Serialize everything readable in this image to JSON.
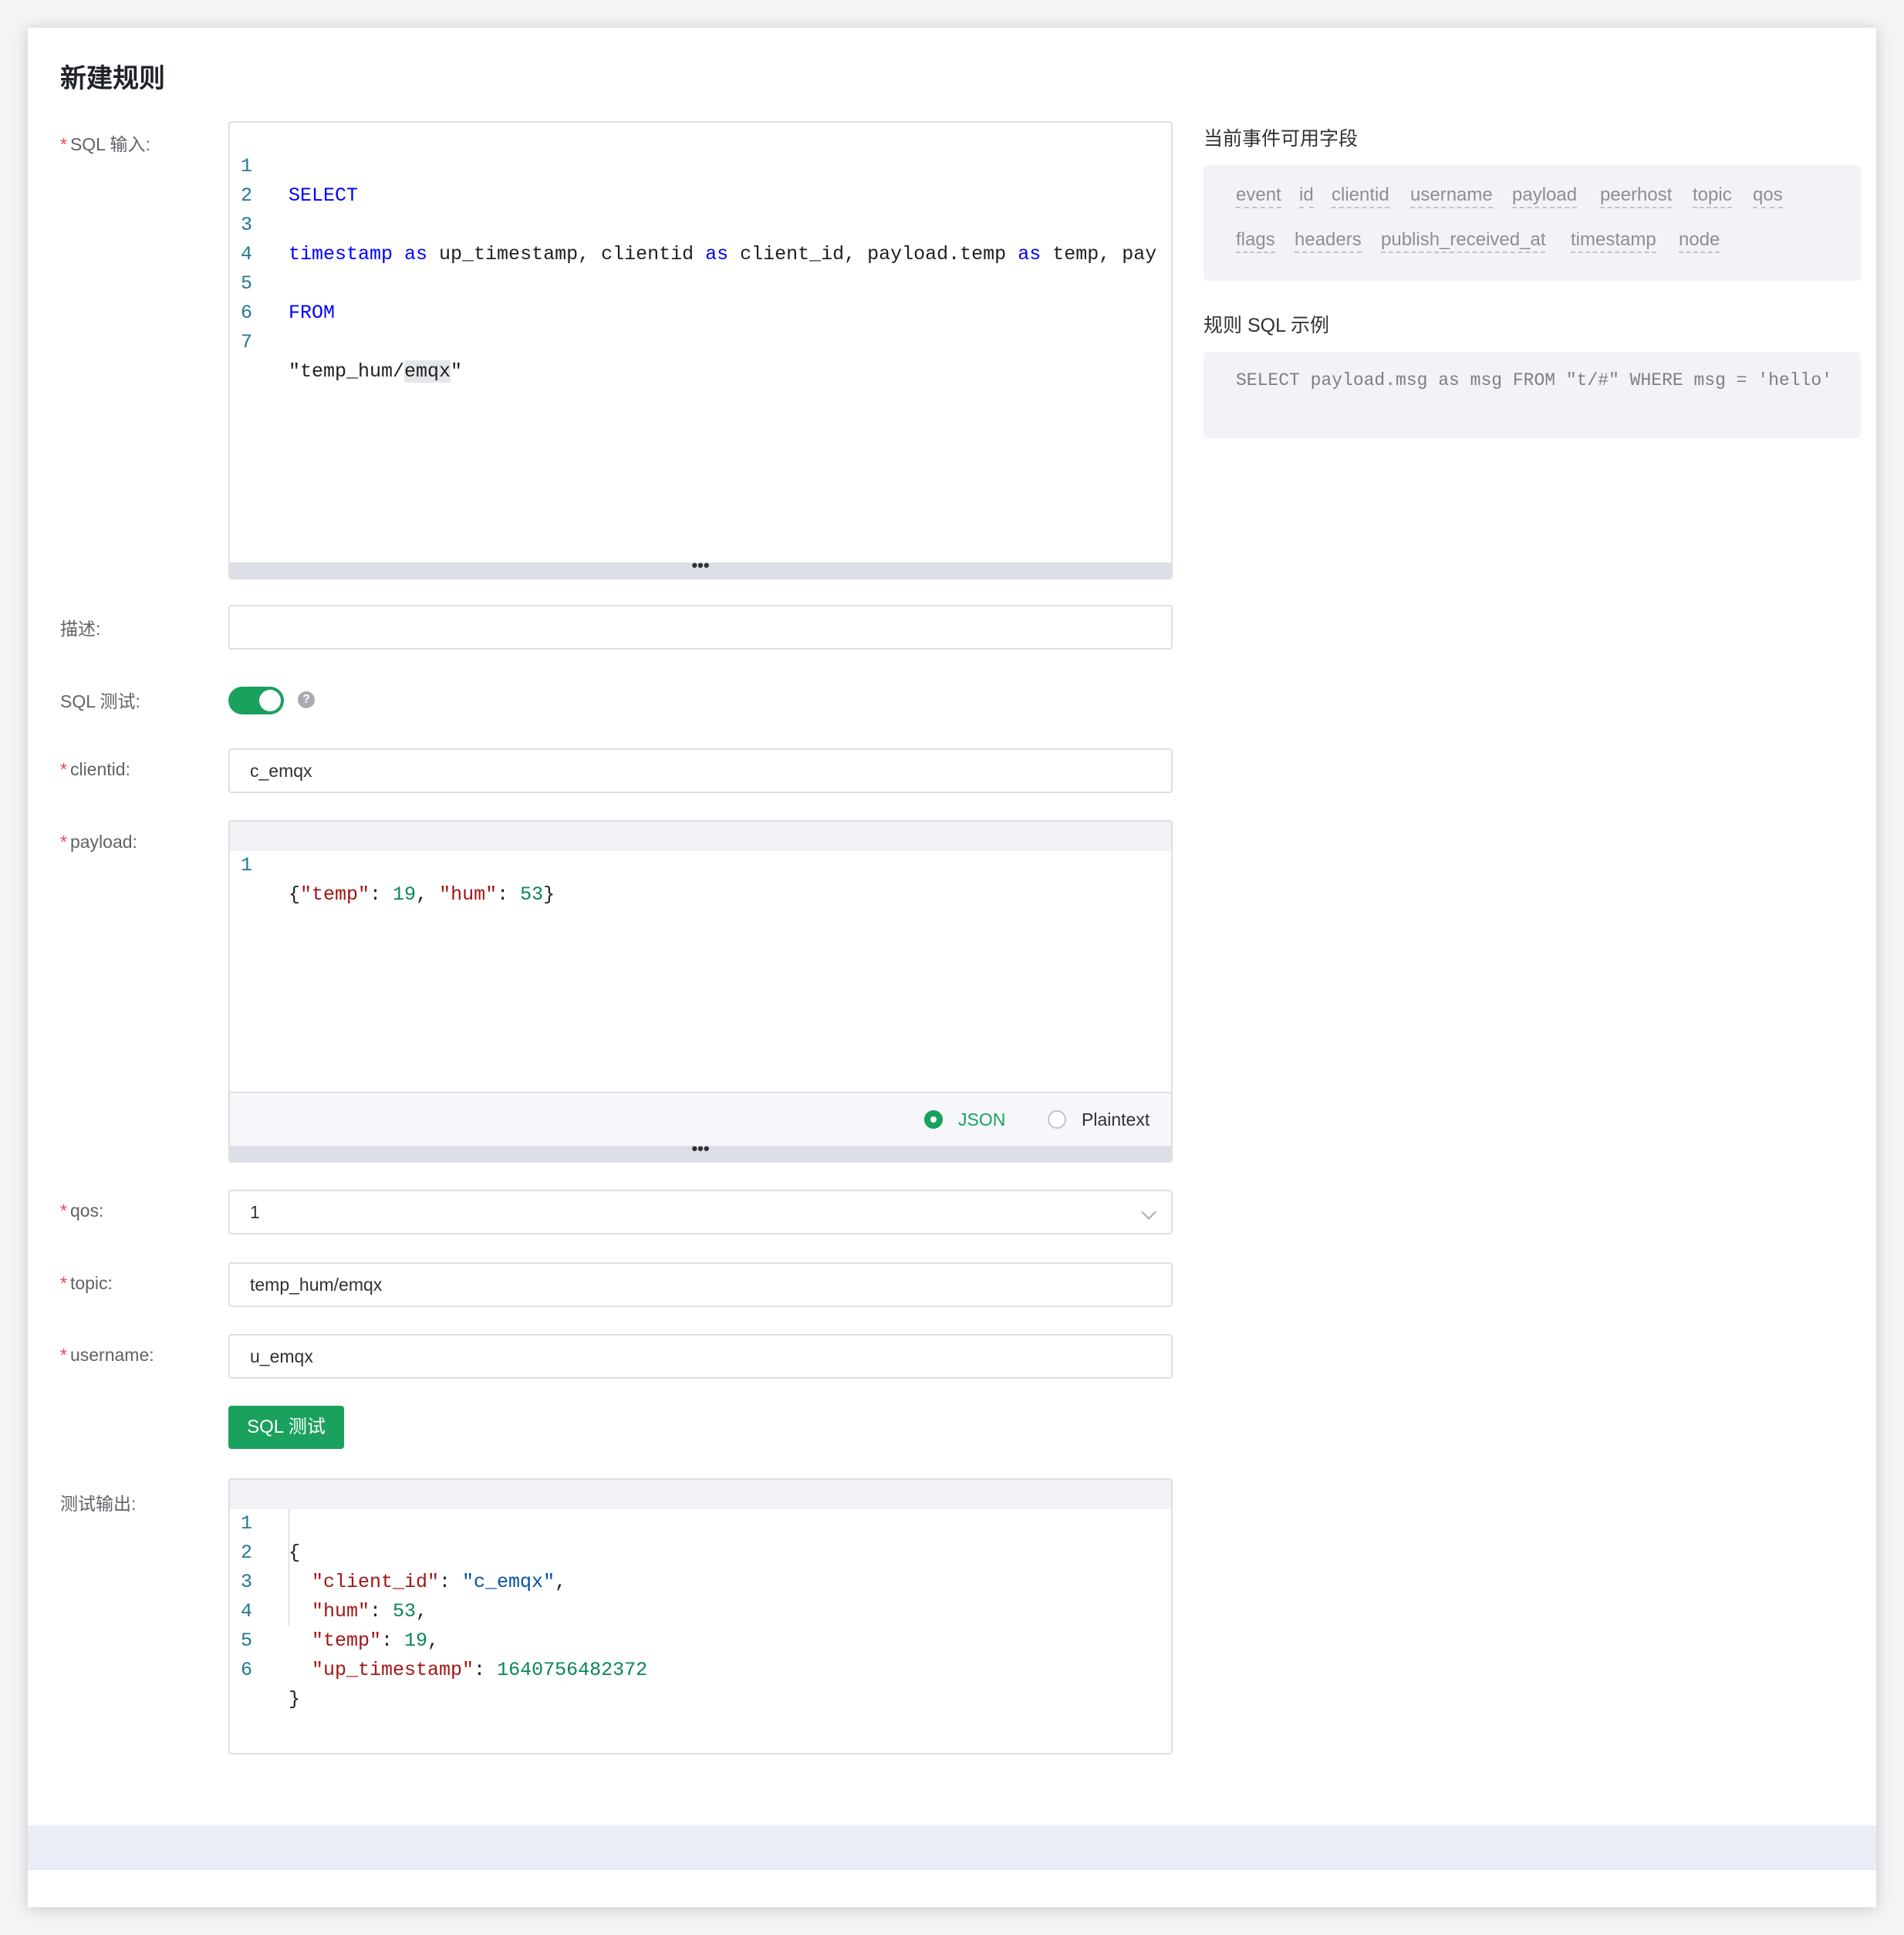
{
  "page": {
    "title": "新建规则"
  },
  "form": {
    "sql_label": "SQL 输入:",
    "desc_label": "描述:",
    "desc_value": "",
    "sql_test_label": "SQL 测试:",
    "clientid_label": "clientid:",
    "clientid_value": "c_emqx",
    "payload_label": "payload:",
    "qos_label": "qos:",
    "qos_value": "1",
    "topic_label": "topic:",
    "topic_value": "temp_hum/emqx",
    "username_label": "username:",
    "username_value": "u_emqx",
    "test_button": "SQL 测试",
    "output_label": "测试输出:",
    "help_icon": "?",
    "resize_handle": "•••",
    "required_mark": "*"
  },
  "sql_editor": {
    "line_numbers": [
      "1",
      "2",
      "3",
      "4",
      "5",
      "6",
      "7"
    ],
    "line1": "SELECT",
    "line3_parts": [
      "timestamp",
      " as ",
      "up_timestamp, clientid",
      " as ",
      "client_id, payload.temp",
      " as ",
      "temp, pay"
    ],
    "line5": "FROM",
    "line7_parts": [
      "\"temp_hum/",
      "emqx",
      "\""
    ]
  },
  "payload_editor": {
    "line_numbers": [
      "1"
    ],
    "parts": [
      "{",
      "\"temp\"",
      ": ",
      "19",
      ", ",
      "\"hum\"",
      ": ",
      "53",
      "}"
    ],
    "format_options": [
      {
        "label": "JSON",
        "checked": true
      },
      {
        "label": "Plaintext",
        "checked": false
      }
    ]
  },
  "output_editor": {
    "line_numbers": [
      "1",
      "2",
      "3",
      "4",
      "5",
      "6"
    ],
    "open_brace": "{",
    "close_brace": "}",
    "rows": [
      {
        "key": "\"client_id\"",
        "value": "\"c_emqx\"",
        "kind": "string",
        "comma": ","
      },
      {
        "key": "\"hum\"",
        "value": "53",
        "kind": "number",
        "comma": ","
      },
      {
        "key": "\"temp\"",
        "value": "19",
        "kind": "number",
        "comma": ","
      },
      {
        "key": "\"up_timestamp\"",
        "value": "1640756482372",
        "kind": "number",
        "comma": ""
      }
    ]
  },
  "sidebar": {
    "fields_title": "当前事件可用字段",
    "fields": [
      "event",
      "id",
      "clientid",
      "username",
      "payload",
      "peerhost",
      "topic",
      "qos",
      "flags",
      "headers",
      "publish_received_at",
      "timestamp",
      "node"
    ],
    "example_title": "规则 SQL 示例",
    "example_sql": "SELECT payload.msg as msg FROM \"t/#\" WHERE msg = 'hello'"
  },
  "colors": {
    "primary": "#1aa15e",
    "required": "#e5484d"
  }
}
